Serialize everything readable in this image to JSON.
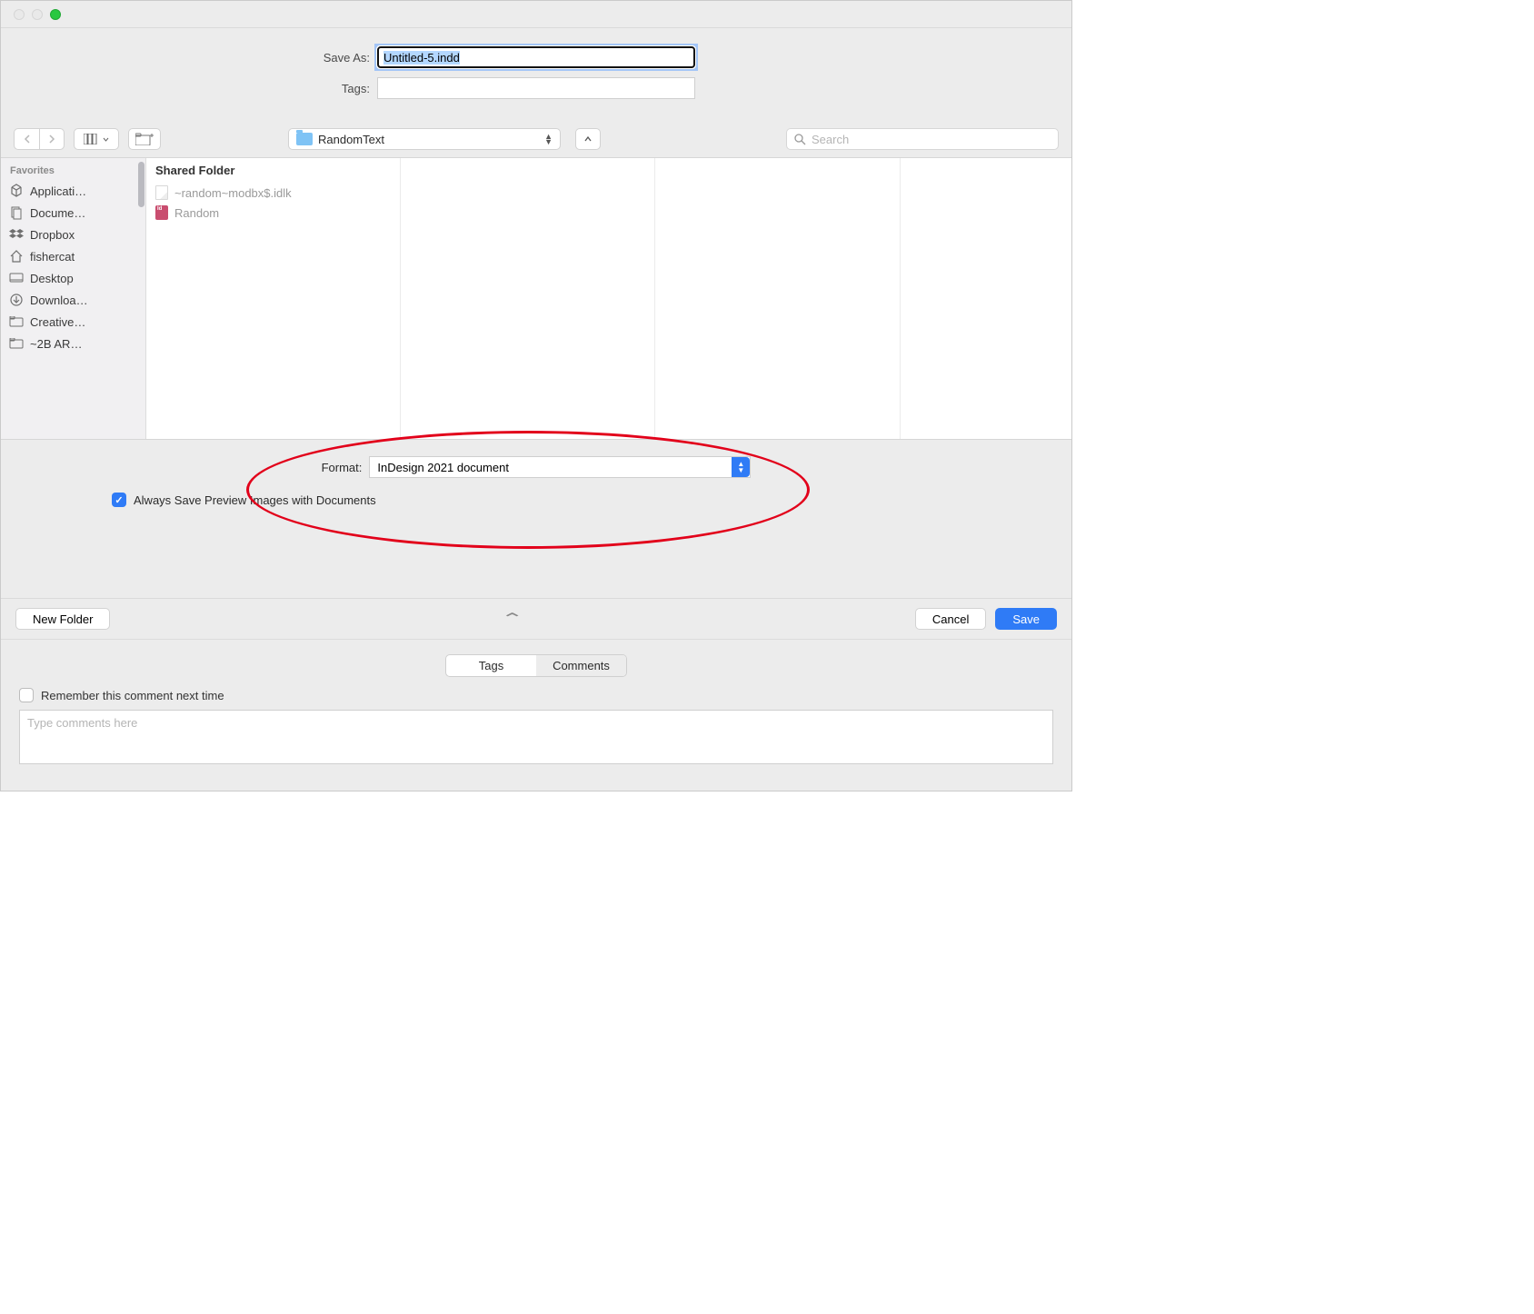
{
  "saveas": {
    "label": "Save As:",
    "value": "Untitled-5.indd"
  },
  "tags": {
    "label": "Tags:",
    "value": ""
  },
  "location": {
    "folder": "RandomText"
  },
  "search": {
    "placeholder": "Search"
  },
  "sidebar": {
    "header": "Favorites",
    "items": [
      {
        "icon": "applications-icon",
        "label": "Applicati…"
      },
      {
        "icon": "documents-icon",
        "label": "Docume…"
      },
      {
        "icon": "dropbox-icon",
        "label": "Dropbox"
      },
      {
        "icon": "home-icon",
        "label": "fishercat"
      },
      {
        "icon": "desktop-icon",
        "label": "Desktop"
      },
      {
        "icon": "downloads-icon",
        "label": "Downloa…"
      },
      {
        "icon": "folder-icon",
        "label": "Creative…"
      },
      {
        "icon": "folder-icon",
        "label": "~2B AR…"
      }
    ]
  },
  "columns": {
    "header": "Shared Folder",
    "files": [
      {
        "type": "generic",
        "name": "~random~modbx$.idlk"
      },
      {
        "type": "indd",
        "name": "Random"
      }
    ]
  },
  "format": {
    "label": "Format:",
    "value": "InDesign 2021 document"
  },
  "preview_checkbox": {
    "checked": true,
    "label": "Always Save Preview Images with Documents"
  },
  "buttons": {
    "newfolder": "New Folder",
    "cancel": "Cancel",
    "save": "Save"
  },
  "tabs": {
    "tags": "Tags",
    "comments": "Comments"
  },
  "remember": {
    "checked": false,
    "label": "Remember this comment next time"
  },
  "comments_placeholder": "Type comments here"
}
